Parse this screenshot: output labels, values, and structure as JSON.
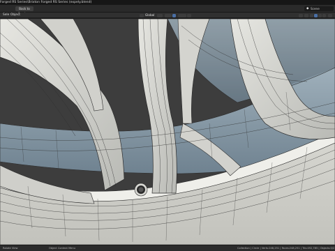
{
  "window": {
    "title": "Forged RS Series\\Brixton Forged RS Series (expely.blend)"
  },
  "topbar": {
    "back_label": "Back to Previous",
    "scene_icon": "scene-icon",
    "scene_label": "Scene"
  },
  "header": {
    "menu_view": "Sele",
    "menu_object": "Object",
    "transform_orientation": "Global"
  },
  "statusbar": {
    "left": "Rotate View",
    "middle": "Object Context Menu",
    "right": "Collection | Circle | Verts:248,251 | Faces:248,251 | Tris:492,785 | Objects:0/2"
  },
  "colors": {
    "mesh_face": "#d9d9d4",
    "wire": "#2b2b2b",
    "background": "#3a3a3a",
    "inner_barrel": "#8ea0ac"
  }
}
